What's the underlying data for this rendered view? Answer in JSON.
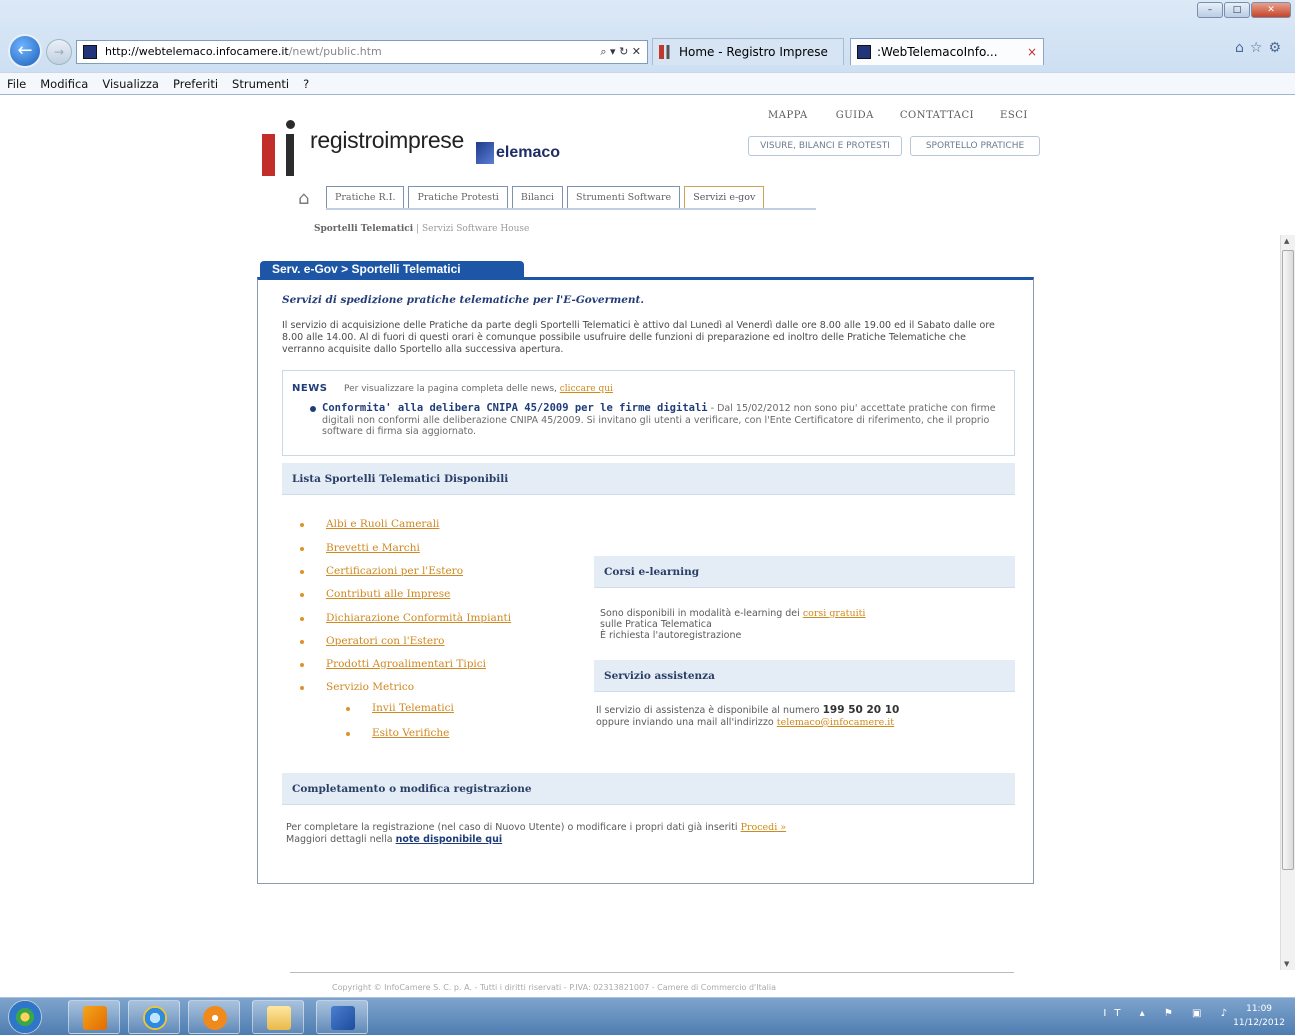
{
  "browser": {
    "url_host": "http://webtelemaco.infocamere.it",
    "url_path": "/newt/public.htm",
    "address_tools": "⌕ ▾ ↻ ✕",
    "tabs": [
      {
        "label": "Home - Registro Imprese"
      },
      {
        "label": ":WebTelemacoInfo..."
      }
    ],
    "tab_close": "×",
    "menu": [
      "File",
      "Modifica",
      "Visualizza",
      "Preferiti",
      "Strumenti",
      "?"
    ],
    "window_buttons": {
      "minimize": "–",
      "maximize": "□",
      "close": "✕"
    },
    "right_icons": "⌂☆⚙"
  },
  "header": {
    "logo_text": "registroimprese",
    "telemaco_text": "elemaco",
    "top_links": [
      "MAPPA",
      "GUIDA",
      "CONTATTACI",
      "ESCI"
    ],
    "top_buttons": [
      "VISURE, BILANCI E PROTESTI",
      "SPORTELLO PRATICHE"
    ],
    "nav_tabs": [
      "Pratiche R.I.",
      "Pratiche Protesti",
      "Bilanci",
      "Strumenti Software",
      "Servizi e-gov"
    ],
    "home_icon": "⌂",
    "subnav_active": "Sportelli Telematici",
    "subnav_sep": "|",
    "subnav_other": "Servizi Software House"
  },
  "main": {
    "section_tab": "Serv. e-Gov > Sportelli Telematici",
    "intro_title": "Servizi di spedizione pratiche telematiche per l'E-Goverment.",
    "intro_text": "Il servizio di acquisizione delle Pratiche da parte degli Sportelli Telematici è attivo dal Lunedì al Venerdì dalle ore 8.00 alle 19.00 ed il Sabato dalle ore 8.00 alle 14.00. Al di fuori di questi orari è comunque possibile usufruire delle funzioni di preparazione ed inoltro delle Pratiche Telematiche che verranno acquisite dallo Sportello alla successiva apertura.",
    "news": {
      "label": "NEWS",
      "text": "Per visualizzare la pagina completa delle news,",
      "link": "cliccare qui",
      "item_title": "Conformita' alla delibera CNIPA 45/2009 per le firme digitali",
      "item_text": "- Dal 15/02/2012 non sono piu' accettate pratiche con firme digitali non conformi alle deliberazione CNIPA 45/2009. Si invitano gli utenti a verificare, con l'Ente Certificatore di riferimento, che il proprio software di firma sia aggiornato."
    },
    "lista": {
      "title": "Lista Sportelli Telematici Disponibili",
      "items": [
        "Albi e Ruoli Camerali",
        "Brevetti e Marchi",
        "Certificazioni per l'Estero",
        "Contributi alle Imprese",
        "Dichiarazione Conformità Impianti",
        "Operatori con l'Estero",
        "Prodotti Agroalimentari Tipici",
        "Servizio Metrico"
      ],
      "subitems": [
        "Invii Telematici",
        "Esito Verifiche"
      ]
    },
    "corsi": {
      "title": "Corsi e-learning",
      "text_before": "Sono disponibili in modalità e-learning dei",
      "link": "corsi gratuiti",
      "text_after": "sulle Pratica Telematica",
      "text_line3": "È richiesta l'autoregistrazione"
    },
    "assistenza": {
      "title": "Servizio assistenza",
      "text_before": "Il servizio di assistenza è disponibile al numero",
      "phone": "199 50 20 10",
      "text_mid": "oppure inviando una mail all'indirizzo",
      "email": "telemaco@infocamere.it"
    },
    "completamento": {
      "title": "Completamento o modifica registrazione",
      "text": "Per completare la registrazione (nel caso di Nuovo Utente) o modificare i propri dati già inseriti",
      "link": "Procedi »",
      "text2": "Maggiori dettagli nella",
      "link2": "note disponibile qui"
    },
    "footer": "Copyright © InfoCamere S. C. p. A. - Tutti i diritti riservati - P.IVA: 02313821007 - Camere di Commercio d'Italia"
  },
  "taskbar": {
    "tray": "IT ▴ ⚑ ▣ ♪",
    "time": "11:09",
    "date": "11/12/2012"
  },
  "colors": {
    "brand_red": "#c22f2a",
    "brand_blue": "#1d56a6",
    "link_orange": "#d08820"
  }
}
